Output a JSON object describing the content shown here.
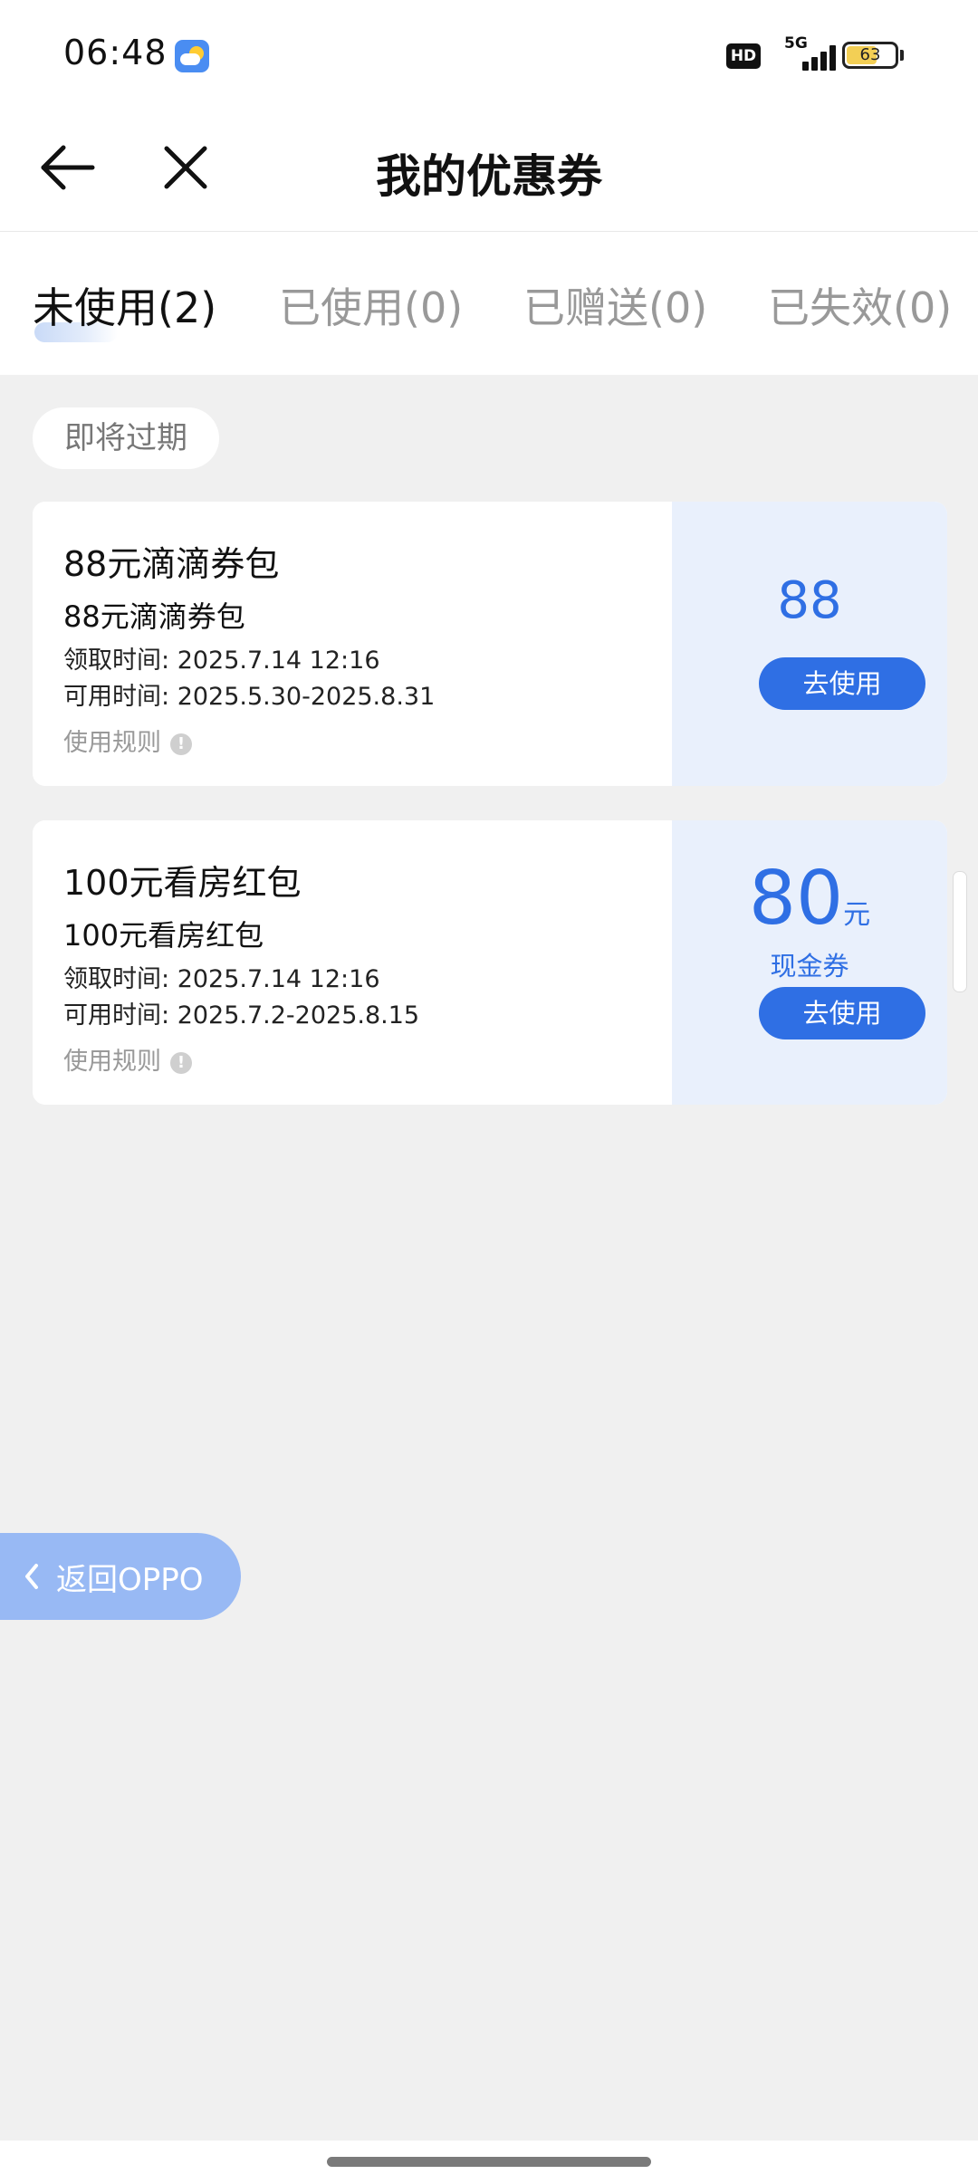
{
  "status_bar": {
    "time": "06:48",
    "weather_icon": "weather-partly-sunny-icon",
    "hd_label": "HD",
    "network_label": "5G",
    "battery_level": "63",
    "battery_fraction": 0.63
  },
  "nav": {
    "title": "我的优惠券",
    "back_icon": "arrow-left-icon",
    "close_icon": "close-icon"
  },
  "tabs": [
    {
      "label": "未使用(2)",
      "active": true
    },
    {
      "label": "已使用(0)",
      "active": false
    },
    {
      "label": "已赠送(0)",
      "active": false
    },
    {
      "label": "已失效(0)",
      "active": false
    }
  ],
  "filter": {
    "label": "即将过期"
  },
  "coupons": [
    {
      "title": "88元滴滴券包",
      "subtitle": "88元滴滴券包",
      "claim_label": "领取时间: ",
      "claim_time": "2025.7.14 12:16",
      "valid_label": "可用时间: ",
      "valid_period": "2025.5.30-2025.8.31",
      "rules_label": "使用规则",
      "amount": "88",
      "unit": "",
      "type": "",
      "button_label": "去使用"
    },
    {
      "title": "100元看房红包",
      "subtitle": "100元看房红包",
      "claim_label": "领取时间: ",
      "claim_time": "2025.7.14 12:16",
      "valid_label": "可用时间: ",
      "valid_period": "2025.7.2-2025.8.15",
      "rules_label": "使用规则",
      "amount": "80",
      "unit": "元",
      "type": "现金券",
      "button_label": "去使用"
    }
  ],
  "return_button": {
    "label": "返回OPPO",
    "icon": "chevron-left-icon"
  },
  "colors": {
    "accent": "#2f6fe4",
    "coupon_panel": "#e9f0fc",
    "page_background": "#f0f0f0",
    "return_pill": "#98b9f4"
  }
}
